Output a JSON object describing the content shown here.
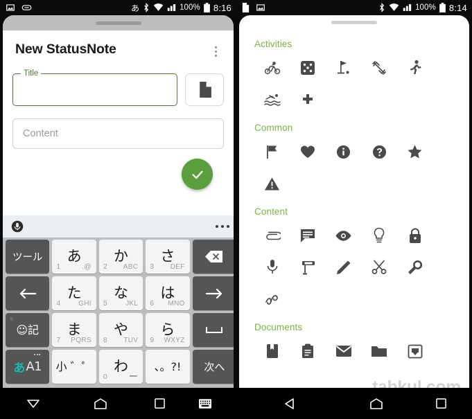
{
  "left_phone": {
    "status_bar": {
      "left_icons": [
        "image-icon",
        "link-icon"
      ],
      "ime_indicator": "あ",
      "right_icons": [
        "bluetooth-icon",
        "wifi-icon",
        "signal-icon"
      ],
      "battery_percent": "100%",
      "clock": "8:16"
    },
    "app": {
      "title": "New StatusNote",
      "overflow_menu": "more-options",
      "title_field": {
        "label": "Title",
        "value": "",
        "placeholder": ""
      },
      "attach_button": "file-icon",
      "content_field": {
        "placeholder": "Content",
        "value": ""
      },
      "save_fab": "check-icon"
    },
    "keyboard": {
      "toolbar": {
        "mic": "mic-icon",
        "overflow": "more-options"
      },
      "rows": [
        [
          {
            "key": "tool",
            "label": "ツール",
            "style": "dark"
          },
          {
            "key": "a",
            "main": "あ",
            "num": "1",
            "alpha": ".@",
            "style": "light"
          },
          {
            "key": "ka",
            "main": "か",
            "num": "2",
            "alpha": "ABC",
            "style": "light"
          },
          {
            "key": "sa",
            "main": "さ",
            "num": "3",
            "alpha": "DEF",
            "style": "light"
          },
          {
            "key": "backspace",
            "label": "backspace-icon",
            "style": "dark"
          }
        ],
        [
          {
            "key": "left",
            "label": "arrow-left-icon",
            "style": "dark"
          },
          {
            "key": "ta",
            "main": "た",
            "num": "4",
            "alpha": "GHI",
            "style": "light"
          },
          {
            "key": "na",
            "main": "な",
            "num": "5",
            "alpha": "JKL",
            "style": "light"
          },
          {
            "key": "ha",
            "main": "は",
            "num": "6",
            "alpha": "MNO",
            "style": "light"
          },
          {
            "key": "right",
            "label": "arrow-right-icon",
            "style": "dark"
          }
        ],
        [
          {
            "key": "emoji",
            "label": "☺記",
            "style": "dark"
          },
          {
            "key": "ma",
            "main": "ま",
            "num": "7",
            "alpha": "PQRS",
            "style": "light"
          },
          {
            "key": "ya",
            "main": "や",
            "num": "8",
            "alpha": "TUV",
            "style": "light"
          },
          {
            "key": "ra",
            "main": "ら",
            "num": "9",
            "alpha": "WXYZ",
            "style": "light"
          },
          {
            "key": "space",
            "label": "space-icon",
            "style": "dark"
          }
        ],
        [
          {
            "key": "mode",
            "label": "あA1",
            "style": "dark"
          },
          {
            "key": "small",
            "main": "小 ゛゜",
            "style": "light"
          },
          {
            "key": "wa",
            "main": "わ",
            "num": "0",
            "alpha": "ー",
            "style": "light"
          },
          {
            "key": "punct",
            "main": "、。?!",
            "style": "light"
          },
          {
            "key": "next",
            "label": "次へ",
            "style": "dark"
          }
        ]
      ]
    },
    "nav_bar": [
      "hide-keyboard-icon",
      "home-icon",
      "recents-icon",
      "switch-keyboard-icon"
    ]
  },
  "right_phone": {
    "status_bar": {
      "left_icons": [
        "document-icon",
        "image-icon"
      ],
      "right_icons": [
        "bluetooth-icon",
        "wifi-icon",
        "signal-icon"
      ],
      "battery_percent": "100%",
      "clock": "8:14"
    },
    "picker": {
      "categories": [
        {
          "title": "Activities",
          "icons": [
            "bike-icon",
            "dice-icon",
            "golf-icon",
            "sports-icon",
            "run-icon",
            "pool-icon",
            "gamepad-icon"
          ]
        },
        {
          "title": "Common",
          "icons": [
            "flag-icon",
            "heart-icon",
            "info-icon",
            "help-icon",
            "star-icon",
            "warning-icon"
          ]
        },
        {
          "title": "Content",
          "icons": [
            "attachment-icon",
            "comment-icon",
            "eye-icon",
            "lightbulb-icon",
            "lock-icon",
            "mic-icon",
            "paint-roller-icon",
            "pencil-icon",
            "scissors-icon",
            "wrench-icon",
            "gesture-icon"
          ]
        },
        {
          "title": "Documents",
          "icons": [
            "book-icon",
            "clipboard-icon",
            "mail-icon",
            "folder-icon",
            "inbox-icon"
          ]
        }
      ]
    },
    "watermark": "tabkul.com",
    "nav_bar": [
      "back-icon",
      "home-icon",
      "recents-icon"
    ]
  },
  "colors": {
    "accent_green": "#7cb342",
    "field_green": "#4a7a34",
    "fab_green": "#5a9e3d",
    "icon_gray": "#4a4a4a",
    "keyboard_bg": "#bdbdbd",
    "key_dark": "#555555",
    "key_light": "#f4f4f4",
    "mode_teal": "#18b8b0"
  }
}
